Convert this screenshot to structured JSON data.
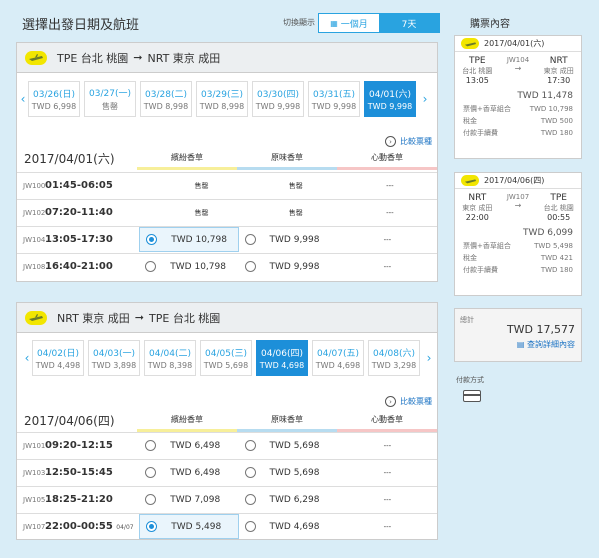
{
  "page_title": "選擇出發日期及航班",
  "view_toggle": {
    "label": "切換顯示",
    "options": [
      {
        "label": "一個月",
        "icon": "calendar-icon"
      },
      {
        "label": "7天"
      }
    ],
    "selected": 1
  },
  "outbound": {
    "origin": "TPE 台北 桃園",
    "destination": "NRT 東京 成田",
    "dates": [
      {
        "date": "03/26(日)",
        "price": "TWD 6,998"
      },
      {
        "date": "03/27(一)",
        "price": "售罄"
      },
      {
        "date": "03/28(二)",
        "price": "TWD 8,998"
      },
      {
        "date": "03/29(三)",
        "price": "TWD 8,998"
      },
      {
        "date": "03/30(四)",
        "price": "TWD 9,998"
      },
      {
        "date": "03/31(五)",
        "price": "TWD 9,998"
      },
      {
        "date": "04/01(六)",
        "price": "TWD 9,998"
      }
    ],
    "selected_date_index": 6,
    "compare_label": "比較票種",
    "flight_date": "2017/04/01(六)",
    "classes": [
      "繽紛香草",
      "原味香草",
      "心動香草"
    ],
    "flights": [
      {
        "no": "JW100",
        "time": "01:45-06:05",
        "next_day": "",
        "fares": [
          "售罄",
          "售罄",
          "---"
        ],
        "selected": -1
      },
      {
        "no": "JW102",
        "time": "07:20-11:40",
        "next_day": "",
        "fares": [
          "售罄",
          "售罄",
          "---"
        ],
        "selected": -1
      },
      {
        "no": "JW104",
        "time": "13:05-17:30",
        "next_day": "",
        "fares": [
          "TWD 10,798",
          "TWD 9,998",
          "---"
        ],
        "selected": 0
      },
      {
        "no": "JW108",
        "time": "16:40-21:00",
        "next_day": "",
        "fares": [
          "TWD 10,798",
          "TWD 9,998",
          "---"
        ],
        "selected": -1
      }
    ]
  },
  "inbound": {
    "origin": "NRT 東京 成田",
    "destination": "TPE 台北 桃園",
    "dates": [
      {
        "date": "04/02(日)",
        "price": "TWD 4,498"
      },
      {
        "date": "04/03(一)",
        "price": "TWD 3,898"
      },
      {
        "date": "04/04(二)",
        "price": "TWD 8,398"
      },
      {
        "date": "04/05(三)",
        "price": "TWD 5,698"
      },
      {
        "date": "04/06(四)",
        "price": "TWD 4,698"
      },
      {
        "date": "04/07(五)",
        "price": "TWD 4,698"
      },
      {
        "date": "04/08(六)",
        "price": "TWD 3,298"
      }
    ],
    "selected_date_index": 4,
    "compare_label": "比較票種",
    "flight_date": "2017/04/06(四)",
    "classes": [
      "繽紛香草",
      "原味香草",
      "心動香草"
    ],
    "flights": [
      {
        "no": "JW101",
        "time": "09:20-12:15",
        "next_day": "",
        "fares": [
          "TWD 6,498",
          "TWD 5,698",
          "---"
        ],
        "selected": -1
      },
      {
        "no": "JW103",
        "time": "12:50-15:45",
        "next_day": "",
        "fares": [
          "TWD 6,498",
          "TWD 5,698",
          "---"
        ],
        "selected": -1
      },
      {
        "no": "JW105",
        "time": "18:25-21:20",
        "next_day": "",
        "fares": [
          "TWD 7,098",
          "TWD 6,298",
          "---"
        ],
        "selected": -1
      },
      {
        "no": "JW107",
        "time": "22:00-00:55",
        "next_day": "04/07",
        "fares": [
          "TWD 5,498",
          "TWD 4,698",
          "---"
        ],
        "selected": 0
      }
    ]
  },
  "summary": {
    "title": "購票內容",
    "legs": [
      {
        "date": "2017/04/01(六)",
        "from_code": "TPE",
        "from_city": "台北 桃園",
        "from_time": "13:05",
        "flight": "JW104",
        "to_code": "NRT",
        "to_city": "東京 成田",
        "to_time": "17:30",
        "total": "TWD 11,478",
        "lines": [
          {
            "label": "票價+香草組合",
            "value": "TWD 10,798"
          },
          {
            "label": "稅金",
            "value": "TWD 500"
          },
          {
            "label": "付款手續費",
            "value": "TWD 180"
          }
        ]
      },
      {
        "date": "2017/04/06(四)",
        "from_code": "NRT",
        "from_city": "東京 成田",
        "from_time": "22:00",
        "flight": "JW107",
        "to_code": "TPE",
        "to_city": "台北 桃園",
        "to_time": "00:55",
        "total": "TWD 6,099",
        "lines": [
          {
            "label": "票價+香草組合",
            "value": "TWD 5,498"
          },
          {
            "label": "稅金",
            "value": "TWD 421"
          },
          {
            "label": "付款手續費",
            "value": "TWD 180"
          }
        ]
      }
    ],
    "total_label": "總計",
    "total_value": "TWD 17,577",
    "detail_link": "查詢詳細內容",
    "payment_label": "付款方式"
  },
  "colors": {
    "accent": "#1d8fd9",
    "class_bars": [
      "#f7ef9a",
      "#b7dcf0",
      "#f6c6c6"
    ]
  }
}
